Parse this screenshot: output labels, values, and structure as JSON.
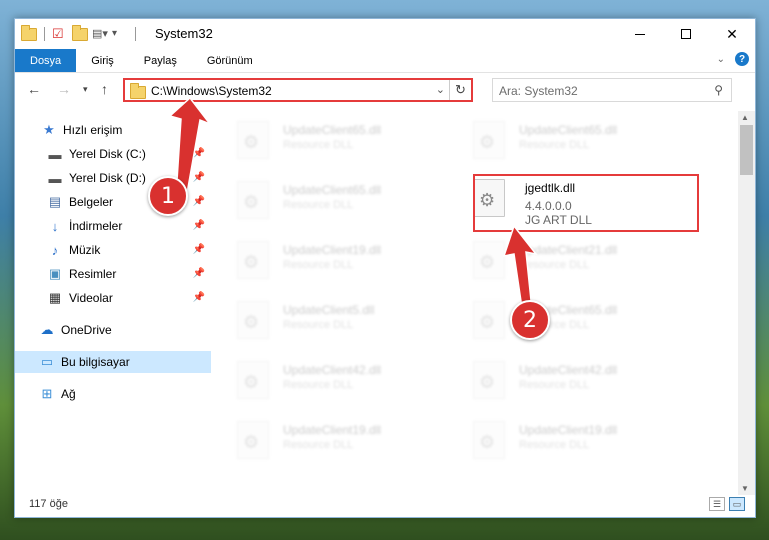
{
  "window": {
    "title": "System32"
  },
  "ribbon": {
    "tabs": [
      {
        "label": "Dosya"
      },
      {
        "label": "Giriş"
      },
      {
        "label": "Paylaş"
      },
      {
        "label": "Görünüm"
      }
    ]
  },
  "navbar": {
    "address": "C:\\Windows\\System32",
    "search_placeholder": "Ara: System32"
  },
  "sidebar": {
    "items": [
      {
        "label": "Hızlı erişim",
        "icon": "star-icon"
      },
      {
        "label": "Yerel Disk (C:)",
        "icon": "drive-icon"
      },
      {
        "label": "Yerel Disk (D:)",
        "icon": "drive-icon"
      },
      {
        "label": "Belgeler",
        "icon": "documents-icon"
      },
      {
        "label": "İndirmeler",
        "icon": "download-icon"
      },
      {
        "label": "Müzik",
        "icon": "music-icon"
      },
      {
        "label": "Resimler",
        "icon": "pictures-icon"
      },
      {
        "label": "Videolar",
        "icon": "videos-icon"
      },
      {
        "label": "OneDrive",
        "icon": "cloud-icon"
      },
      {
        "label": "Bu bilgisayar",
        "icon": "computer-icon"
      },
      {
        "label": "Ağ",
        "icon": "network-icon"
      }
    ]
  },
  "files": {
    "left": [
      {
        "name": "UpdateClient65.dll",
        "type": "Resource DLL"
      },
      {
        "name": "UpdateClient65.dll",
        "type": "Resource DLL"
      },
      {
        "name": "UpdateClient19.dll",
        "type": "Resource DLL"
      },
      {
        "name": "UpdateClient5.dll",
        "type": "Resource DLL"
      },
      {
        "name": "UpdateClient42.dll",
        "type": "Resource DLL"
      },
      {
        "name": "UpdateClient19.dll",
        "type": "Resource DLL"
      }
    ],
    "right": [
      {
        "name": "UpdateClient65.dll",
        "type": "Resource DLL"
      },
      {
        "name": "UpdateClient21.dll",
        "type": "Resource DLL"
      },
      {
        "name": "UpdateClient65.dll",
        "type": "Resource DLL"
      },
      {
        "name": "UpdateClient42.dll",
        "type": "Resource DLL"
      },
      {
        "name": "UpdateClient19.dll",
        "type": "Resource DLL"
      }
    ],
    "highlighted": {
      "name": "jgedtlk.dll",
      "version": "4.4.0.0.0",
      "type": "JG ART DLL"
    }
  },
  "status": {
    "count": "117 öğe"
  },
  "annotations": {
    "badge1": "1",
    "badge2": "2",
    "color": "#d9312f"
  }
}
